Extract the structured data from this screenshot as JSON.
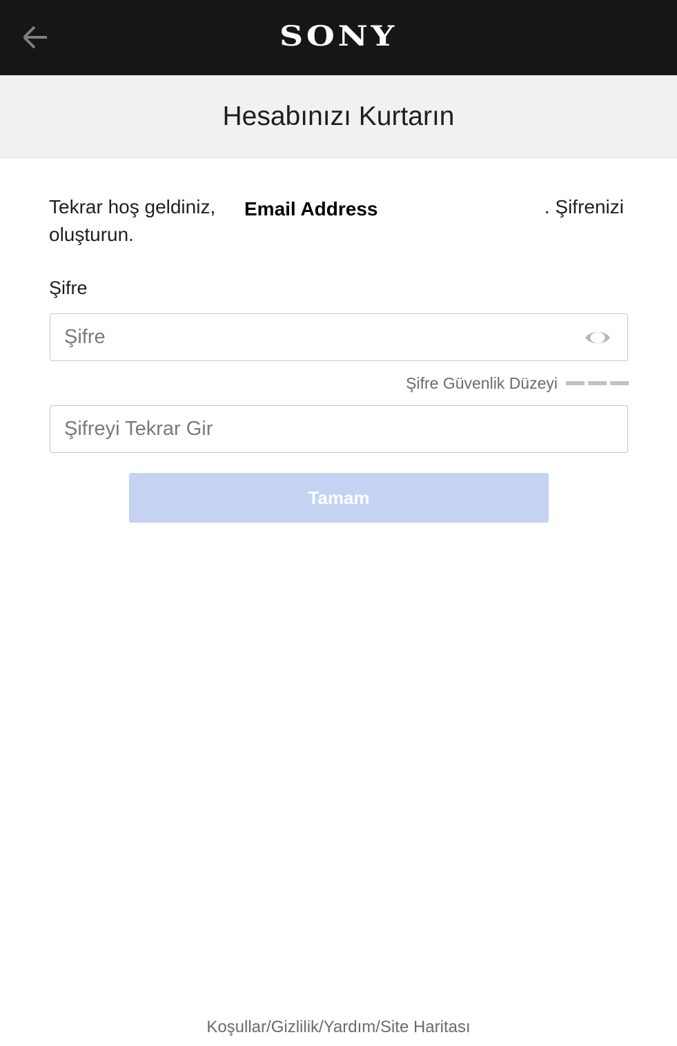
{
  "header": {
    "brand": "SONY",
    "back_icon": "arrow-left-icon"
  },
  "title": "Hesabınızı Kurtarın",
  "welcome": {
    "text_before": "Tekrar hoş geldiniz,",
    "email": "Email Address",
    "text_after": ". Şifrenizi",
    "text_line2": "oluşturun."
  },
  "password": {
    "label": "Şifre",
    "placeholder": "Şifre",
    "value": "",
    "toggle_icon": "eye-icon"
  },
  "strength": {
    "label": "Şifre Güvenlik Düzeyi",
    "level": 0,
    "segments": 3
  },
  "confirm_password": {
    "placeholder": "Şifreyi Tekrar Gir",
    "value": ""
  },
  "submit": {
    "label": "Tamam",
    "enabled": false
  },
  "footer": {
    "links": [
      "Koşullar",
      "Gizlilik",
      "Yardım",
      "Site Haritası"
    ],
    "separator": "/"
  },
  "colors": {
    "topbar": "#161616",
    "title_band": "#f1f1f1",
    "button_disabled": "#c5d2f2",
    "muted_text": "#6b6b6b"
  }
}
